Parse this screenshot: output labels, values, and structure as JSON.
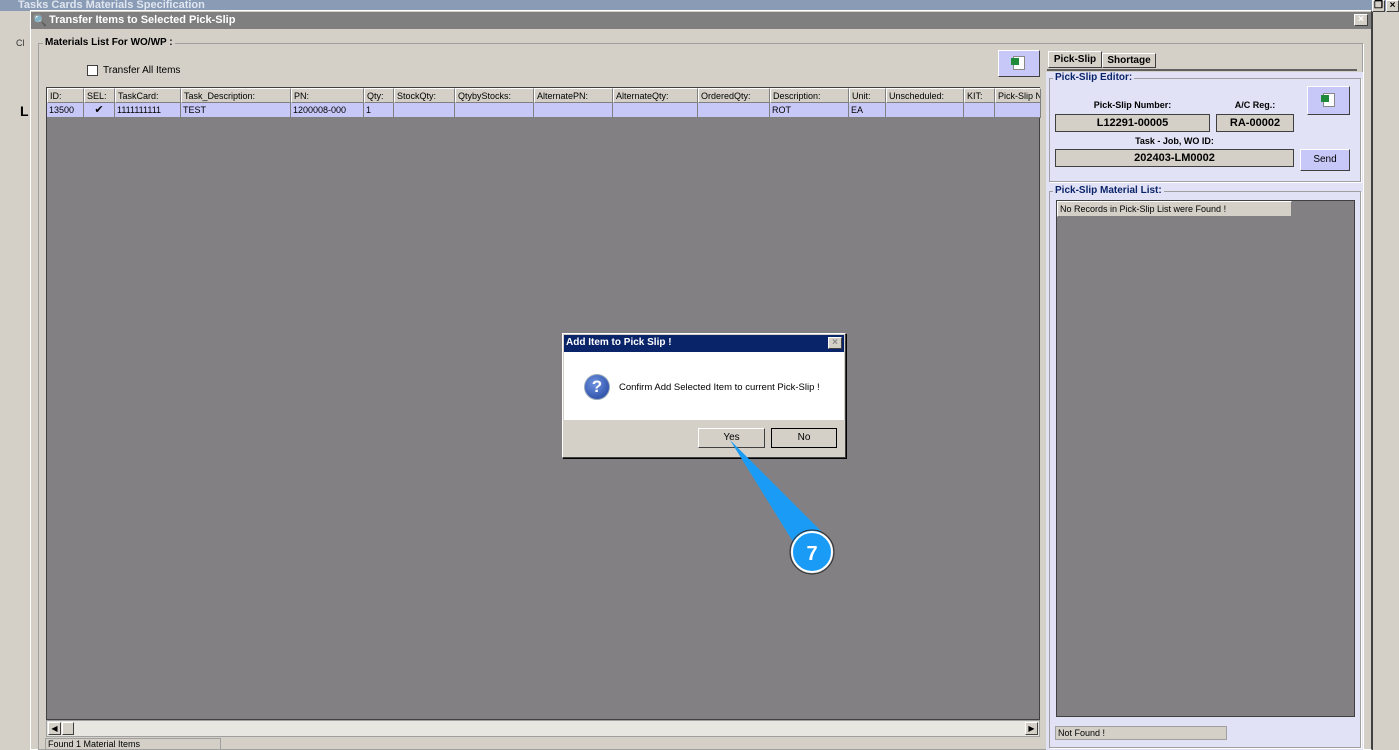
{
  "background_window": {
    "title": "Tasks Cards Materials Specification",
    "toolbar_text": "Cl",
    "section_letter": "L"
  },
  "window": {
    "title": "Transfer Items to Selected Pick-Slip",
    "close": "×"
  },
  "materials": {
    "group_label": "Materials List For WO/WP :",
    "transfer_all_label": "Transfer All Items",
    "transfer_all_checked": false,
    "columns": [
      "ID:",
      "SEL:",
      "TaskCard:",
      "Task_Description:",
      "PN:",
      "Qty:",
      "StockQty:",
      "QtybyStocks:",
      "AlternatePN:",
      "AlternateQty:",
      "OrderedQty:",
      "Description:",
      "Unit:",
      "Unscheduled:",
      "KIT:",
      "Pick-Slip N"
    ],
    "rows": [
      {
        "id": "13500",
        "sel": "✔",
        "taskcard": "1111111111",
        "task_description": "TEST",
        "pn": "1200008-000",
        "qty": "1",
        "stockqty": "",
        "qtybystocks": "",
        "alternatepn": "",
        "alternateqty": "",
        "orderedqty": "",
        "description": "ROT",
        "unit": "EA",
        "unscheduled": "",
        "kit": "",
        "pickslip": ""
      }
    ],
    "status": "Found 1 Material Items"
  },
  "tabs": [
    "Pick-Slip",
    "Shortage"
  ],
  "editor": {
    "group_label": "Pick-Slip Editor:",
    "pick_slip_number_label": "Pick-Slip Number:",
    "pick_slip_number": "L12291-00005",
    "ac_reg_label": "A/C Reg.:",
    "ac_reg": "RA-00002",
    "task_job_label": "Task - Job, WO ID:",
    "task_job": "202403-LM0002",
    "send_label": "Send"
  },
  "material_list": {
    "group_label": "Pick-Slip Material List:",
    "empty_message": "No Records in Pick-Slip List were Found !",
    "status": "Not Found !"
  },
  "dialog": {
    "title": "Add Item to Pick Slip !",
    "message": "Confirm Add Selected Item to current Pick-Slip !",
    "yes": "Yes",
    "no": "No",
    "close": "×"
  },
  "annotation": {
    "step": "7",
    "color": "#1a9bf5"
  }
}
